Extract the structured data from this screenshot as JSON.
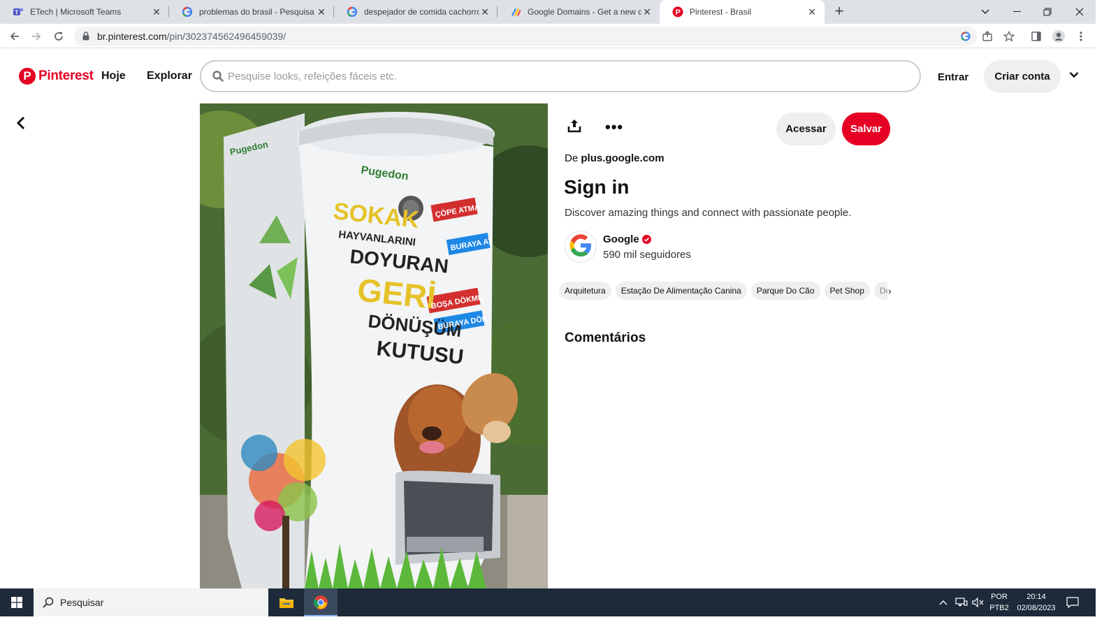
{
  "browser": {
    "tabs": [
      {
        "title": "ETech | Microsoft Teams",
        "icon": "teams-icon"
      },
      {
        "title": "problemas do brasil - Pesquisa Go",
        "icon": "google-icon"
      },
      {
        "title": "despejador de comida cachorro -",
        "icon": "google-icon"
      },
      {
        "title": "Google Domains - Get a new dom",
        "icon": "google-domains-icon"
      },
      {
        "title": "Pinterest - Brasil",
        "icon": "pinterest-icon"
      }
    ],
    "url_host": "br.pinterest.com",
    "url_path": "/pin/302374562496459039/"
  },
  "header": {
    "logo_text": "Pinterest",
    "nav_today": "Hoje",
    "nav_explore": "Explorar",
    "search_placeholder": "Pesquise looks, refeições fáceis etc.",
    "login": "Entrar",
    "signup": "Criar conta"
  },
  "pin": {
    "image_words": {
      "brand": "Pugedon",
      "line1": "SOKAK",
      "line2": "HAYVANLARINI",
      "line3": "DOYURAN",
      "line4": "GERİ",
      "line5": "DÖNÜŞÜM",
      "line6": "KUTUSU",
      "badge1a": "ÇÖPE ATMA",
      "badge1b": "BURAYA AT",
      "badge2a": "BOŞA DÖKME",
      "badge2b": "BURAYA DÖK"
    },
    "visit_label": "Acessar",
    "save_label": "Salvar",
    "source_prefix": "De",
    "source_domain": "plus.google.com",
    "title": "Sign in",
    "description": "Discover amazing things and connect with passionate people.",
    "creator_name": "Google",
    "creator_followers": "590 mil seguidores",
    "tags": [
      "Arquitetura",
      "Estação De Alimentação Canina",
      "Parque Do Cão",
      "Pet Shop",
      "Decora"
    ],
    "comments_heading": "Comentários"
  },
  "taskbar": {
    "search_text": "Pesquisar",
    "lang_top": "POR",
    "lang_bottom": "PTB2",
    "time": "20:14",
    "date": "02/08/2023"
  },
  "colors": {
    "pinterest_red": "#e60023",
    "taskbar": "#1c2a3a"
  }
}
